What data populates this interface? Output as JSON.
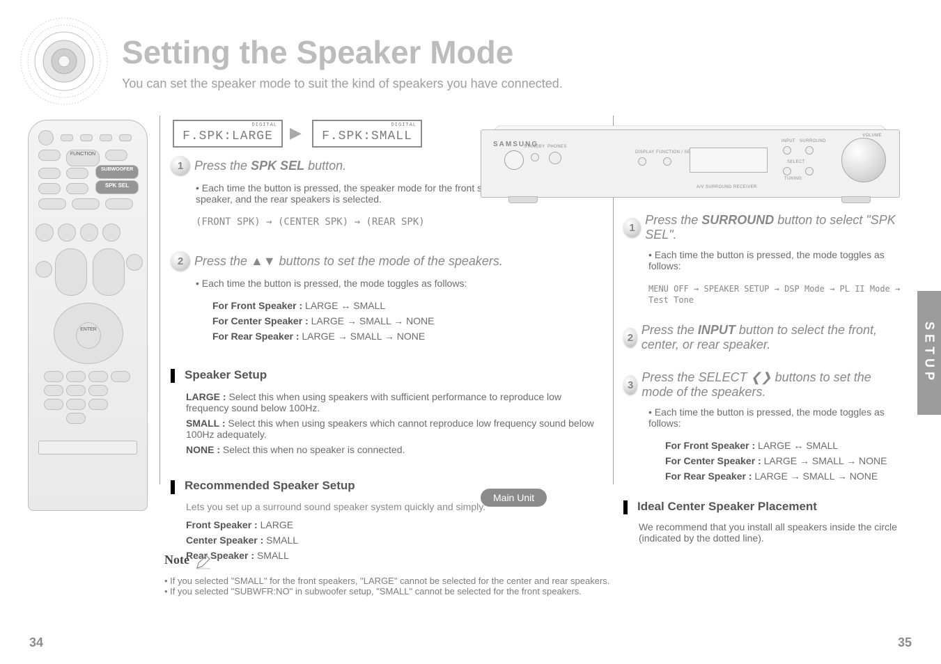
{
  "page": {
    "left_number": "34",
    "right_number": "35",
    "title": "Setting the Speaker Mode",
    "subtitle": "You can set the speaker mode to suit the kind of speakers you have connected.",
    "edge_tab": "SETUP"
  },
  "screens": {
    "digital_label": "DIGITAL",
    "large": "F.SPK:LARGE",
    "small": "F.SPK:SMALL"
  },
  "left_col": {
    "step1": {
      "num": "1",
      "line1": "Press the ",
      "spk_sel": "SPK SEL",
      "line2": " button.",
      "sub": "Each time the button is pressed, the speaker mode for the front speakers, the center speaker, and the rear speakers is selected.",
      "detail1": "(FRONT SPK) → (CENTER SPK) → (REAR SPK)"
    },
    "step2": {
      "num": "2",
      "line": "Press the ▲▼ buttons to set the mode of the speakers.",
      "bullet_intro": "Each time the button is pressed, the mode toggles as follows:",
      "modes": [
        {
          "label": "For Front Speaker :",
          "value": "LARGE ↔ SMALL"
        },
        {
          "label": "For Center Speaker :",
          "value": "LARGE → SMALL → NONE"
        },
        {
          "label": "For Rear Speaker :",
          "value": "LARGE → SMALL → NONE"
        }
      ]
    },
    "setup_heading": "Speaker Setup",
    "setup": [
      {
        "label": "LARGE :",
        "value": "Select this when using speakers with sufficient performance to reproduce low frequency sound below 100Hz."
      },
      {
        "label": "SMALL :",
        "value": "Select this when using speakers which cannot reproduce low frequency sound below 100Hz adequately."
      },
      {
        "label": "NONE :",
        "value": "Select this when no speaker is connected."
      }
    ],
    "recommend_heading": "Recommended Speaker Setup",
    "recommend_intro": "Lets you set up a surround sound speaker system quickly and simply.",
    "recommend": [
      {
        "label": "Front Speaker :",
        "value": "LARGE"
      },
      {
        "label": "Center Speaker :",
        "value": "SMALL"
      },
      {
        "label": "Rear Speaker :",
        "value": "SMALL"
      }
    ]
  },
  "main_unit_pill": "Main Unit",
  "unit": {
    "brand": "SAMSUNG",
    "caption": "A/V SURROUND RECEIVER",
    "labels": {
      "standby": "STANDBY",
      "phones": "PHONES",
      "display": "DISPLAY",
      "function": "FUNCTION / SEARCH",
      "input": "INPUT",
      "surround": "SURROUND",
      "select": "SELECT",
      "tuning": "TUNING",
      "volume": "VOLUME"
    }
  },
  "right_col": {
    "step1": {
      "num": "1",
      "line": "Press the ",
      "spk_sel": "SURROUND",
      "line2": " button to select \"SPK SEL\".",
      "sub": "Each time the button is pressed, the mode toggles as follows:",
      "detail": "MENU OFF → SPEAKER SETUP → DSP Mode → PL II Mode → Test Tone"
    },
    "step2": {
      "num": "2",
      "line": "Press the ",
      "btn": "INPUT",
      "line2": " button to select the front, center, or rear speaker."
    },
    "step3": {
      "num": "3",
      "line": "Press the SELECT ❮❯ buttons to set the mode of the speakers.",
      "bullet_intro": "Each time the button is pressed, the mode toggles as follows:",
      "modes": [
        {
          "label": "For Front Speaker :",
          "value": "LARGE ↔ SMALL"
        },
        {
          "label": "For Center Speaker :",
          "value": "LARGE → SMALL → NONE"
        },
        {
          "label": "For Rear Speaker :",
          "value": "LARGE → SMALL → NONE"
        }
      ]
    },
    "setup_heading": "Ideal Center Speaker Placement",
    "setup": [
      {
        "label": "",
        "value": "We recommend that you install all speakers inside the circle (indicated by the dotted line)."
      }
    ]
  },
  "note": {
    "label": "Note",
    "bullets": [
      "If you selected \"SMALL\" for the front speakers, \"LARGE\" cannot be selected for the center and rear speakers.",
      "If you selected \"SUBWFR:NO\" in subwoofer setup, \"SMALL\" cannot be selected for the front speakers."
    ]
  },
  "remote_labels": {
    "function": "FUNCTION",
    "subwoofer": "SUBWOOFER",
    "spk_sel": "SPK SEL"
  }
}
